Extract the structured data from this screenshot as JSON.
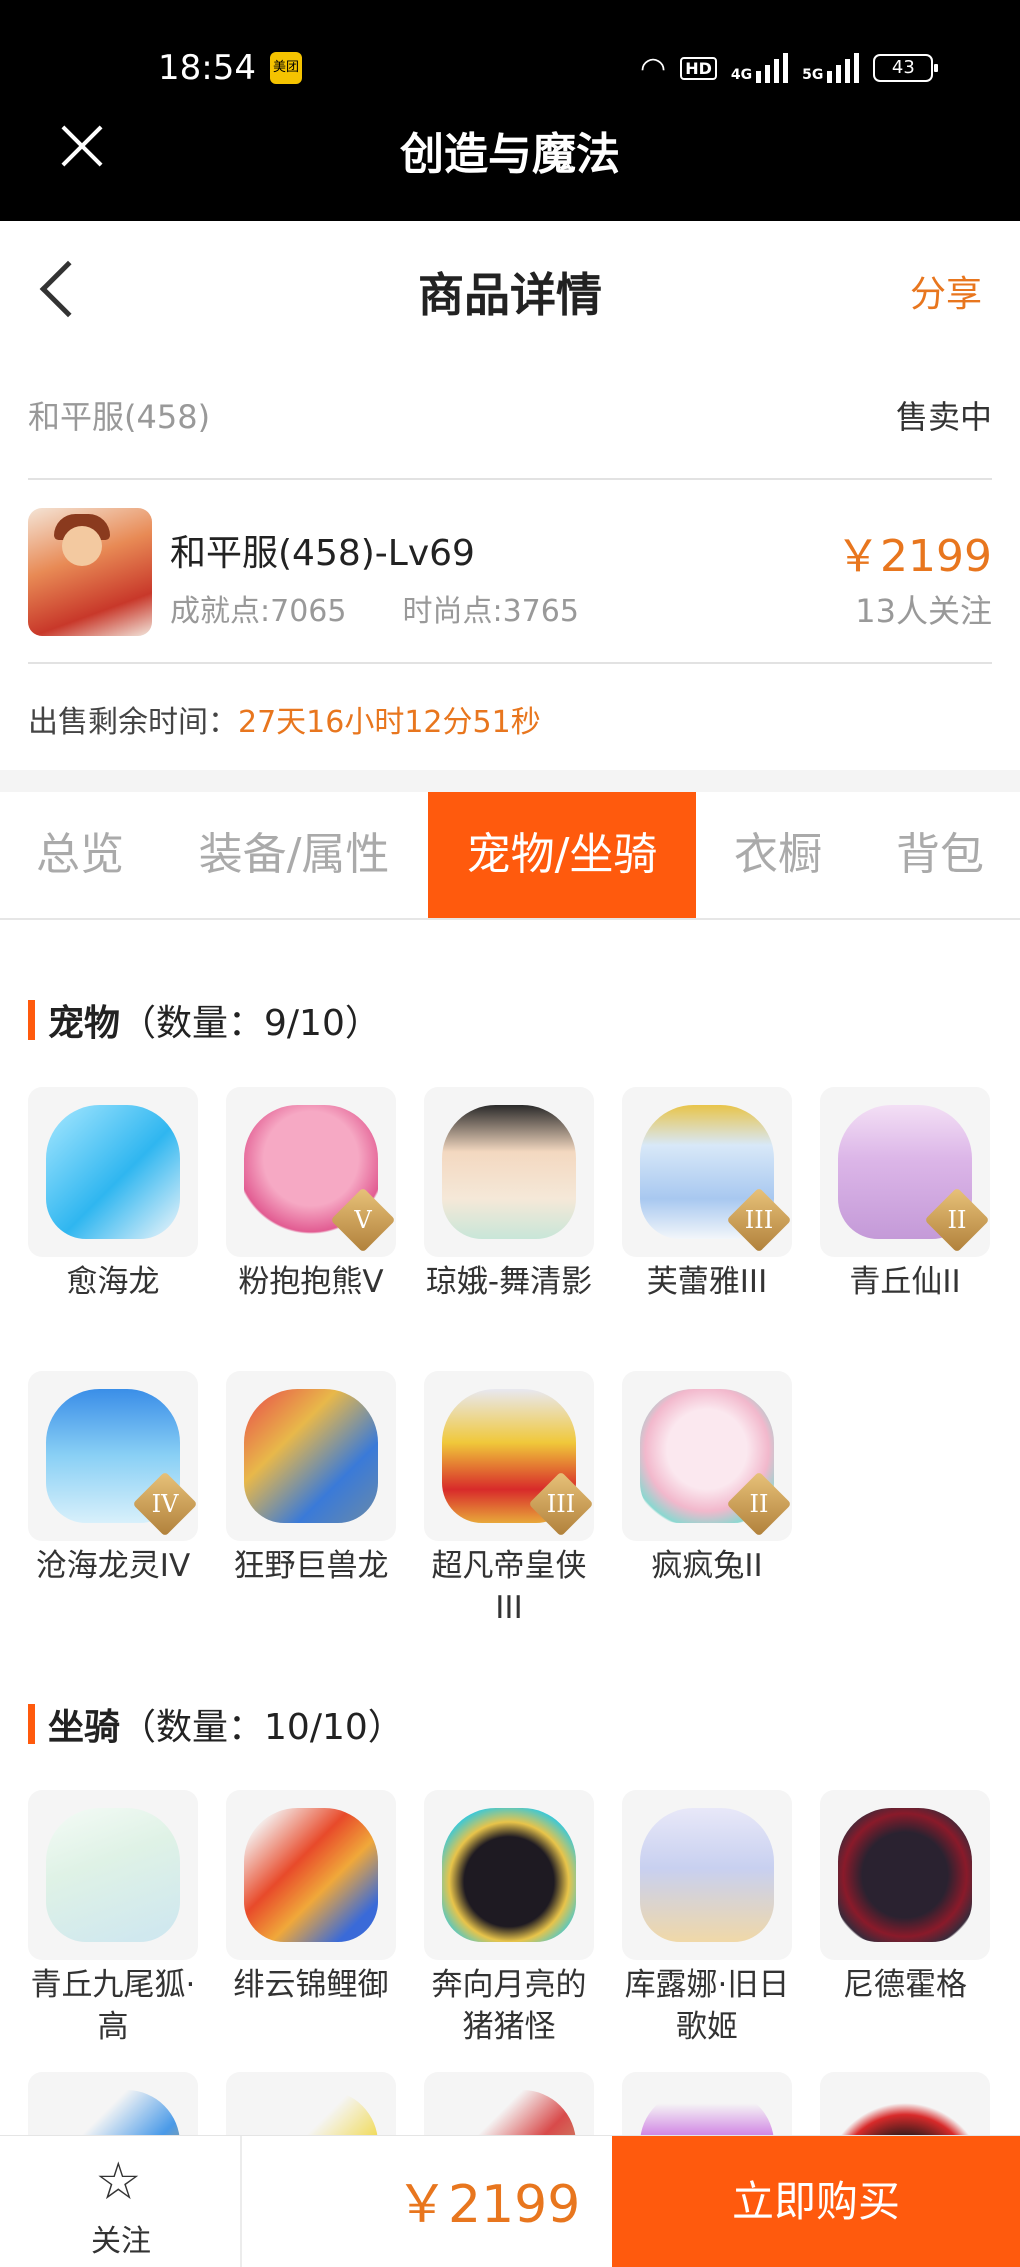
{
  "status_bar": {
    "time": "18:54",
    "meituan": "美团",
    "hd": "HD",
    "net1": "4G",
    "net2": "5G",
    "battery": "43"
  },
  "app": {
    "title": "创造与魔法"
  },
  "nav": {
    "title": "商品详情",
    "share": "分享"
  },
  "server": {
    "name": "和平服(458)",
    "status": "售卖中"
  },
  "product": {
    "name": "和平服(458)-Lv69",
    "achievement": "成就点:7065",
    "fashion": "时尚点:3765",
    "price": "￥2199",
    "followers": "13人关注"
  },
  "remain": {
    "label": "出售剩余时间：",
    "time": "27天16小时12分51秒"
  },
  "tabs": [
    {
      "label": "总览"
    },
    {
      "label": "装备/属性"
    },
    {
      "label": "宠物/坐骑"
    },
    {
      "label": "衣橱"
    },
    {
      "label": "背包"
    }
  ],
  "pets": {
    "title": "宠物",
    "count": "（数量：9/10）",
    "items": [
      {
        "name": "愈海龙",
        "tier": ""
      },
      {
        "name": "粉抱抱熊Ⅴ",
        "tier": "V"
      },
      {
        "name": "琼娥-舞清影",
        "tier": ""
      },
      {
        "name": "芙蕾雅III",
        "tier": "III"
      },
      {
        "name": "青丘仙II",
        "tier": "II"
      },
      {
        "name": "沧海龙灵IV",
        "tier": "IV"
      },
      {
        "name": "狂野巨兽龙",
        "tier": ""
      },
      {
        "name": "超凡帝皇侠III",
        "tier": "III"
      },
      {
        "name": "疯疯兔II",
        "tier": "II"
      }
    ]
  },
  "mounts": {
    "title": "坐骑",
    "count": "（数量：10/10）",
    "items": [
      {
        "name": "青丘九尾狐·高"
      },
      {
        "name": "绯云锦鲤御"
      },
      {
        "name": "奔向月亮的猪猪怪"
      },
      {
        "name": "库露娜·旧日歌姬"
      },
      {
        "name": "尼德霍格"
      }
    ]
  },
  "footer": {
    "follow": "关注",
    "price": "￥2199",
    "buy": "立即购买"
  },
  "colors": {
    "accent": "#ff5a0d",
    "price": "#e8761e"
  }
}
